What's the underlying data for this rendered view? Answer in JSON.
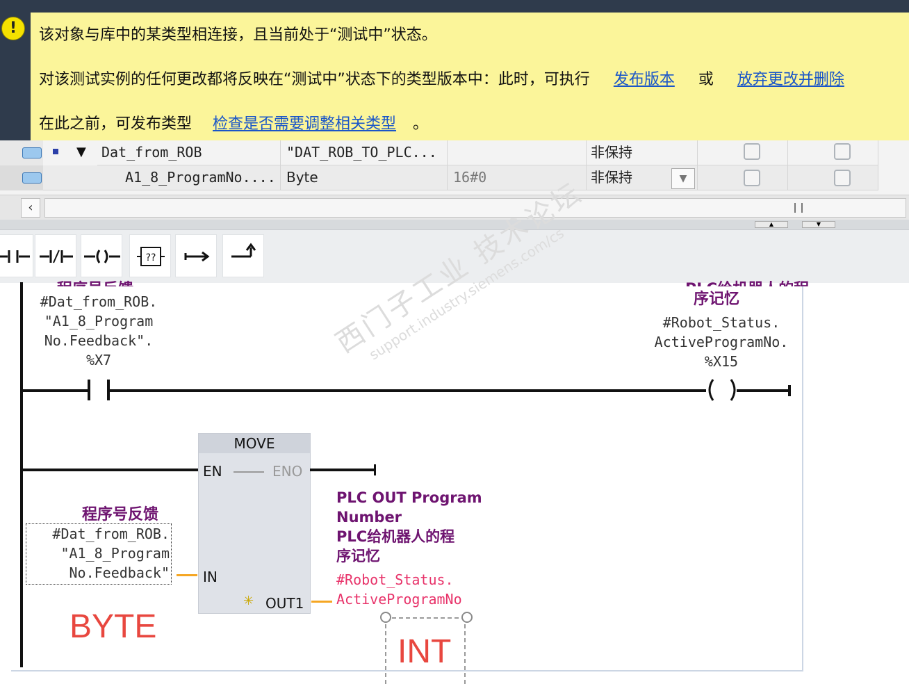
{
  "warning": {
    "line1": "该对象与库中的某类型相连接，且当前处于“测试中”状态。",
    "line2_prefix": "对该测试实例的任何更改都将反映在“测试中”状态下的类型版本中：此时，可执行",
    "link_publish": "发布版本",
    "line2_or": "或",
    "link_discard": "放弃更改并删除",
    "line3_prefix": "在此之前，可发布类型",
    "link_check": "检查是否需要调整相关类型",
    "line3_suffix": "。"
  },
  "table": {
    "rows": [
      {
        "name": "Dat_from_ROB",
        "type": "\"DAT_ROB_TO_PLC...",
        "default": "",
        "retain": "非保持"
      },
      {
        "name": "A1_8_ProgramNo....",
        "type": "Byte",
        "default": "16#0",
        "retain": "非保持"
      }
    ]
  },
  "toolbar": {
    "buttons": [
      {
        "icon": "no-contact-icon",
        "glyph": "⊣⊢"
      },
      {
        "icon": "nc-contact-icon",
        "glyph": "⊣/⊢"
      },
      {
        "icon": "coil-icon",
        "glyph": "–()–"
      },
      {
        "icon": "empty-box-icon",
        "glyph": "??"
      },
      {
        "icon": "open-branch-icon",
        "glyph": "↦"
      },
      {
        "icon": "close-branch-icon",
        "glyph": "↗"
      }
    ]
  },
  "ladder": {
    "net1": {
      "contact_operand": [
        "#Dat_from_ROB.",
        "\"A1_8_Program",
        "No.Feedback\".",
        "%X7"
      ],
      "coil_comment": "序记忆",
      "coil_operand": [
        "#Robot_Status.",
        "ActiveProgramNo.",
        "%X15"
      ]
    },
    "net2": {
      "block_title": "MOVE",
      "en": "EN",
      "eno": "ENO",
      "in": "IN",
      "out1": "OUT1",
      "in_comment": "程序号反馈",
      "in_operand": [
        "#Dat_from_ROB.",
        "\"A1_8_Program",
        "No.Feedback\""
      ],
      "out_comment": [
        "PLC OUT Program",
        "Number",
        "PLC给机器人的程",
        "序记忆"
      ],
      "out_operand": [
        "#Robot_Status.",
        "ActiveProgramNo"
      ],
      "annotation_in": "BYTE",
      "annotation_out": "INT"
    }
  },
  "watermark": {
    "cn": "西门子工业 技术论坛",
    "url": "support.industry.siemens.com/cs"
  },
  "colors": {
    "warning_bg": "#fbf59a",
    "link": "#1a56c8",
    "comment": "#6e1470",
    "annotation_red": "#e8473f",
    "out_operand": "#e8336a",
    "wire_orange": "#f5a623"
  }
}
